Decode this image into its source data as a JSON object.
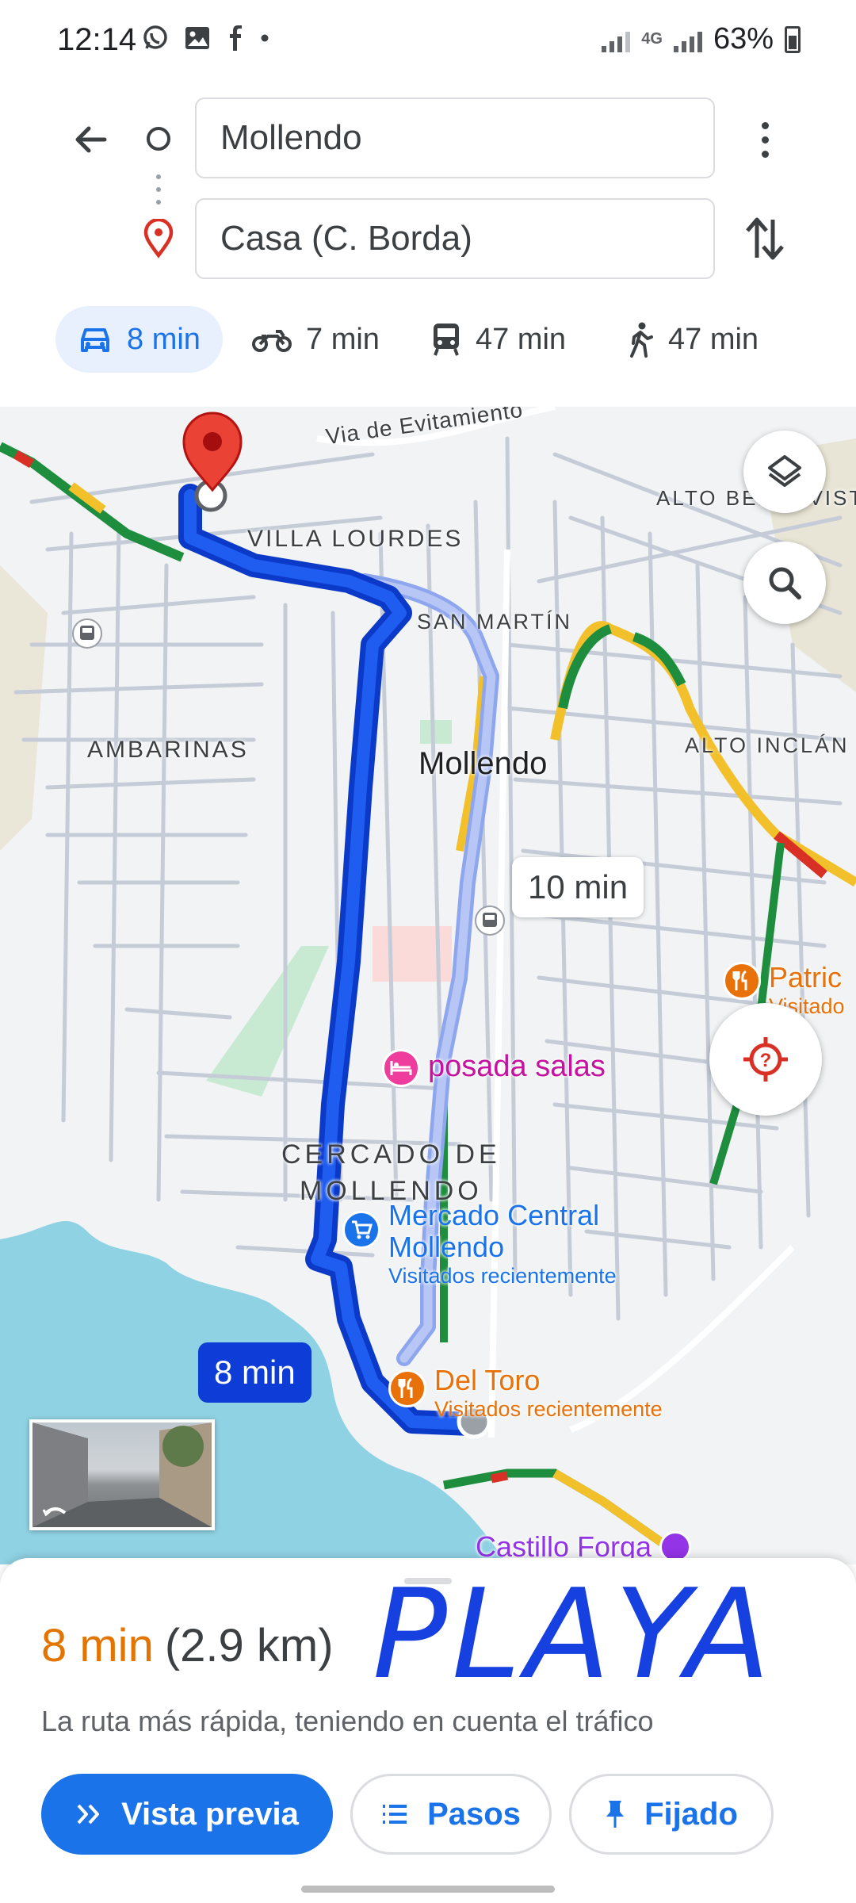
{
  "status_bar": {
    "time": "12:14",
    "network": "4G",
    "battery": "63%"
  },
  "directions": {
    "origin": "Mollendo",
    "destination": "Casa (C. Borda)"
  },
  "modes": [
    {
      "icon": "car-icon",
      "label": "8 min",
      "active": true
    },
    {
      "icon": "motorcycle-icon",
      "label": "7 min",
      "active": false
    },
    {
      "icon": "transit-icon",
      "label": "47 min",
      "active": false
    },
    {
      "icon": "walk-icon",
      "label": "47 min",
      "active": false
    }
  ],
  "map": {
    "labels": {
      "via": "Via de Evitamiento",
      "alto_bella_vista": "ALTO BELLA VISTA",
      "villa_lourdes": "VILLA LOURDES",
      "san_martin": "SAN MARTÍN",
      "ambarinas": "AMBARINAS",
      "mollendo": "Mollendo",
      "alto_inclan": "ALTO INCLÁN",
      "cercado_1": "CERCADO DE",
      "cercado_2": "MOLLENDO"
    },
    "pois": {
      "patrick": {
        "name": "Patric",
        "sub": "Visitado"
      },
      "posada": {
        "name": "posada salas"
      },
      "mercado": {
        "name_1": "Mercado Central",
        "name_2": "Mollendo",
        "sub": "Visitados recientemente"
      },
      "del_toro": {
        "name": "Del Toro",
        "sub": "Visitados recientemente"
      },
      "castillo": {
        "name": "Castillo Forga"
      }
    },
    "route_times": {
      "selected": "8 min",
      "alternate": "10 min"
    }
  },
  "summary": {
    "time": "8 min",
    "distance": "(2.9 km)",
    "description": "La ruta más rápida, teniendo en cuenta el tráfico",
    "handwritten_note": "PLAYA"
  },
  "buttons": {
    "preview": "Vista previa",
    "steps": "Pasos",
    "pinned": "Fijado"
  },
  "colors": {
    "accent": "#1a73e8",
    "route": "#0d3dd6",
    "time_orange": "#e37400",
    "poi_pink": "#c5129f",
    "poi_orange": "#e8710a",
    "poi_blue": "#1a73e8"
  }
}
